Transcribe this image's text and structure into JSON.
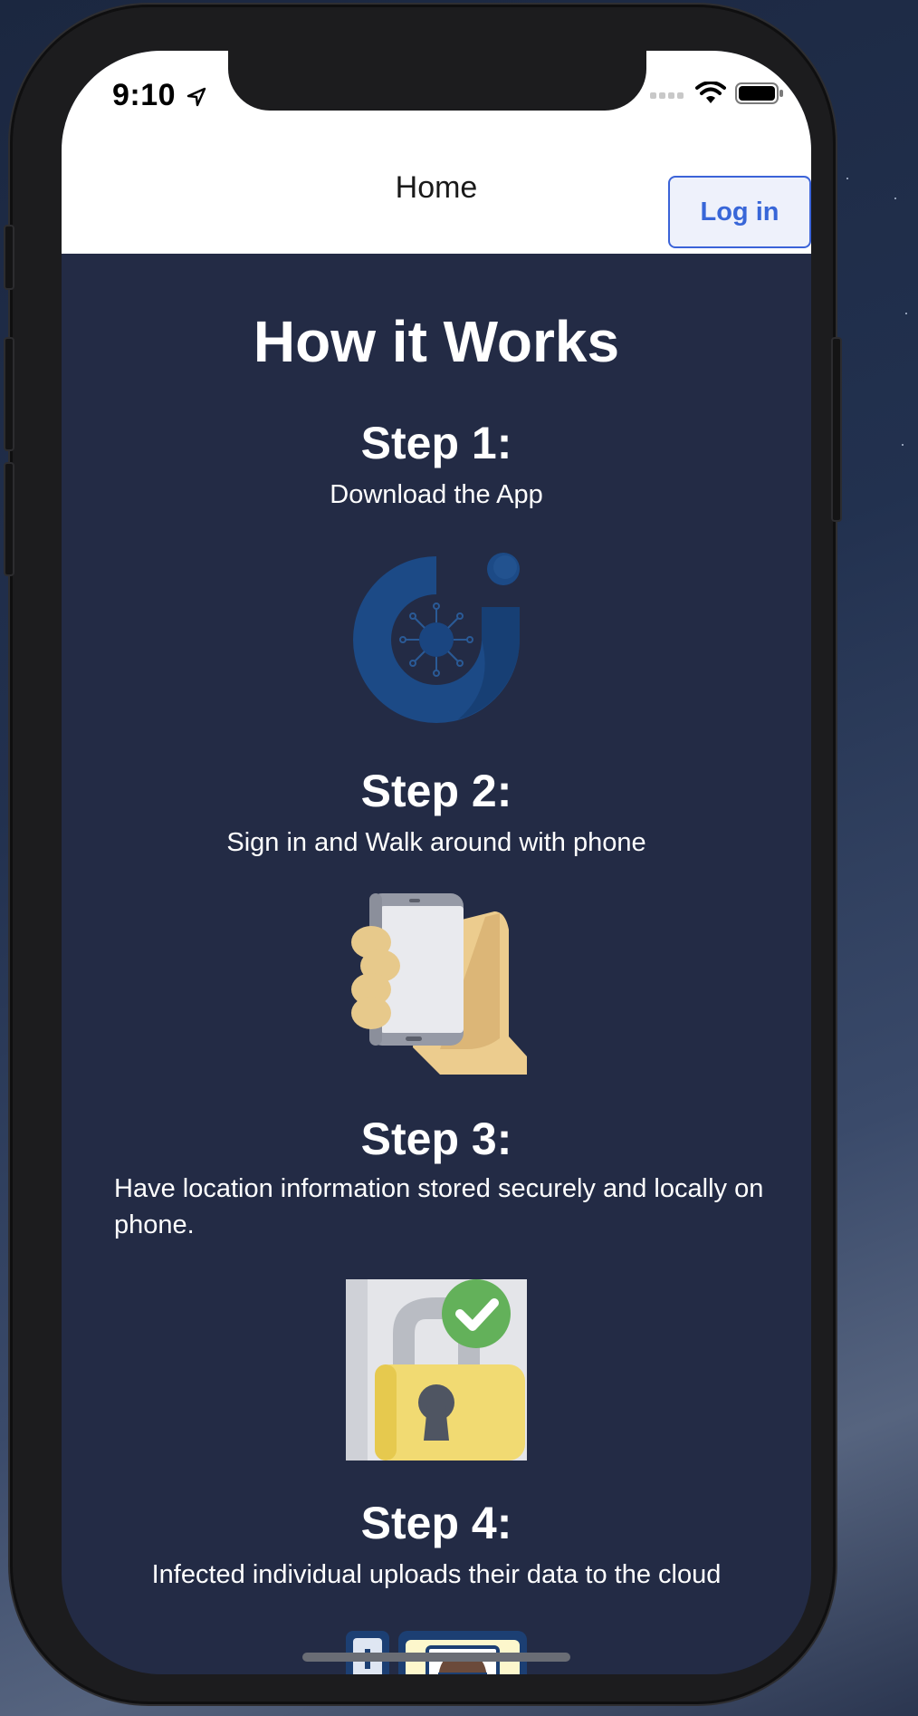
{
  "status_bar": {
    "time": "9:10"
  },
  "nav": {
    "title": "Home",
    "login_label": "Log in"
  },
  "page": {
    "heading": "How it Works",
    "steps": [
      {
        "title": "Step 1:",
        "description": "Download the App",
        "icon": "app-logo-icon"
      },
      {
        "title": "Step 2:",
        "description": "Sign in and Walk around with phone",
        "icon": "hand-holding-phone-icon"
      },
      {
        "title": "Step 3:",
        "description": "Have location information stored securely and locally on phone.",
        "icon": "secure-lock-check-icon"
      },
      {
        "title": "Step 4:",
        "description": "Infected individual uploads their data to the cloud",
        "icon": "patient-in-bed-icon"
      }
    ]
  },
  "colors": {
    "screen_background": "#232b45",
    "login_accent": "#3866d8",
    "logo_blue": "#1c4a86"
  }
}
